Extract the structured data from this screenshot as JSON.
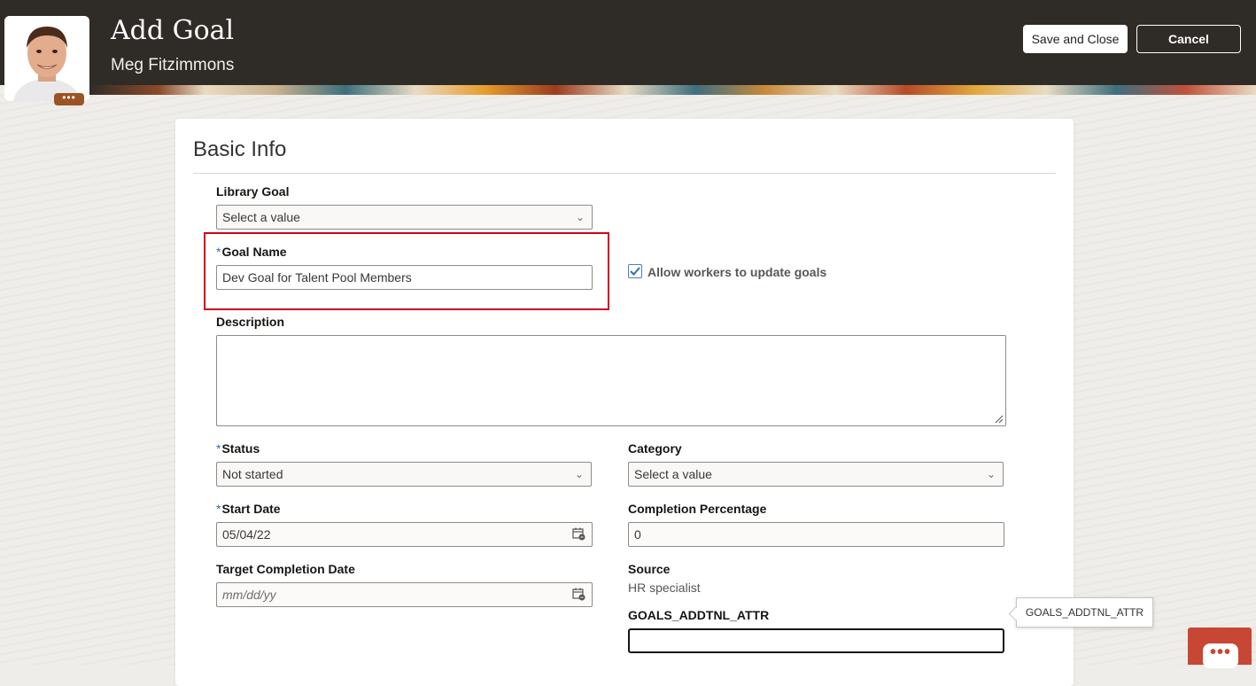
{
  "header": {
    "title": "Add Goal",
    "person_name": "Meg Fitzimmons",
    "avatar_more": "•••",
    "save_close_label": "Save and Close",
    "cancel_label": "Cancel"
  },
  "section": {
    "title": "Basic Info"
  },
  "form": {
    "library_goal": {
      "label": "Library Goal",
      "value": "Select a value"
    },
    "goal_name": {
      "label": "Goal Name",
      "required": "*",
      "value": "Dev Goal for Talent Pool Members"
    },
    "allow_update": {
      "label": "Allow workers to update goals",
      "checked": true
    },
    "description": {
      "label": "Description",
      "value": ""
    },
    "status": {
      "label": "Status",
      "required": "*",
      "value": "Not started"
    },
    "category": {
      "label": "Category",
      "value": "Select a value"
    },
    "start_date": {
      "label": "Start Date",
      "required": "*",
      "value": "05/04/22"
    },
    "completion_percentage": {
      "label": "Completion Percentage",
      "value": "0"
    },
    "target_completion_date": {
      "label": "Target Completion Date",
      "placeholder": "mm/dd/yy"
    },
    "source": {
      "label": "Source",
      "value": "HR specialist"
    },
    "goals_addtnl_attr": {
      "label": "GOALS_ADDTNL_ATTR",
      "value": ""
    }
  },
  "tooltip": {
    "text": "GOALS_ADDTNL_ATTR"
  },
  "chat": {
    "icon": "•••"
  },
  "colors": {
    "header": "#2f2b27",
    "accent_red": "#d0021b",
    "required_blue": "#2e6fad",
    "chat": "#c74634"
  }
}
